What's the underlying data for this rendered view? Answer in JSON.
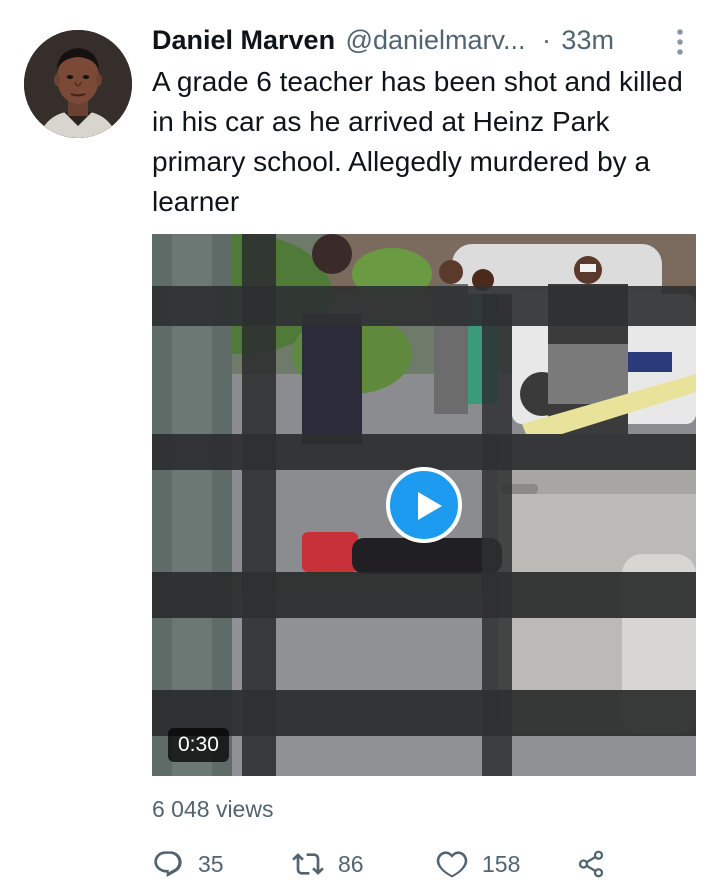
{
  "tweet": {
    "author": {
      "display_name": "Daniel Marven",
      "handle": "@danielmarv...",
      "avatar_icon": "user-avatar"
    },
    "separator": "·",
    "timestamp": "33m",
    "text": "A grade 6 teacher has been shot and killed in his car as he arrived at Heinz Park primary school. Allegedly murdered by a learner",
    "media": {
      "type": "video",
      "duration": "0:30",
      "play_icon": "play-icon"
    },
    "views_text": "6 048 views",
    "actions": {
      "replies": "35",
      "retweets": "86",
      "likes": "158"
    }
  },
  "colors": {
    "accent": "#1d9bf0",
    "text_primary": "#0f1419",
    "text_secondary": "#536471"
  }
}
